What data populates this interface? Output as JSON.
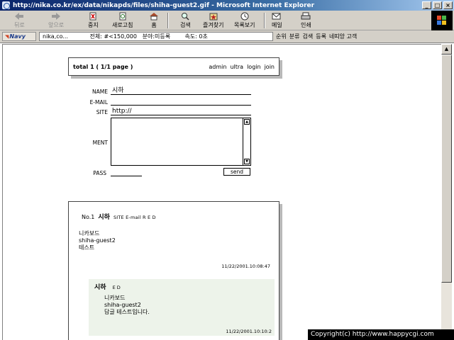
{
  "window": {
    "title": "http://nika.co.kr/ex/data/nikapds/files/shiha-guest2.gif - Microsoft Internet Explorer"
  },
  "toolbar": {
    "back": "뒤로",
    "forward": "앞으로",
    "stop": "중지",
    "refresh": "새로고침",
    "home": "홈",
    "search": "검색",
    "favorites": "즐겨찾기",
    "history": "목록보기",
    "mail": "메일",
    "print": "인쇄"
  },
  "addressbar": {
    "navy": "Navy",
    "address": "nika,co...            전체: #<150,000   분야:미등록        속도: 0초",
    "right_items": [
      "순위",
      "분류",
      "검색",
      "등록",
      "네띠앙 고객"
    ]
  },
  "board": {
    "total": "total 1 ( 1/1 page )",
    "links": [
      "admin",
      "ultra",
      "login",
      "join"
    ]
  },
  "form": {
    "name_label": "NAME",
    "name_value": "시하",
    "email_label": "E-MAIL",
    "email_value": "",
    "site_label": "SITE",
    "site_value": "http://",
    "ment_label": "MENT",
    "pass_label": "PASS",
    "send_label": "send"
  },
  "post": {
    "no": "No.1",
    "name": "시하",
    "meta": "SITE  E-mail  R  E  D",
    "lines": [
      "니카보드",
      "shiha-guest2",
      "테스트"
    ],
    "date": "11/22/2001.10:08:47"
  },
  "reply": {
    "name": "시하",
    "meta": "E  D",
    "lines": [
      "니카보드",
      "shiha-guest2",
      "답글 테스트입니다."
    ],
    "date": "11/22/2001.10:10:2"
  },
  "copyright": "Copyright(c) http://www.happycgi.com"
}
